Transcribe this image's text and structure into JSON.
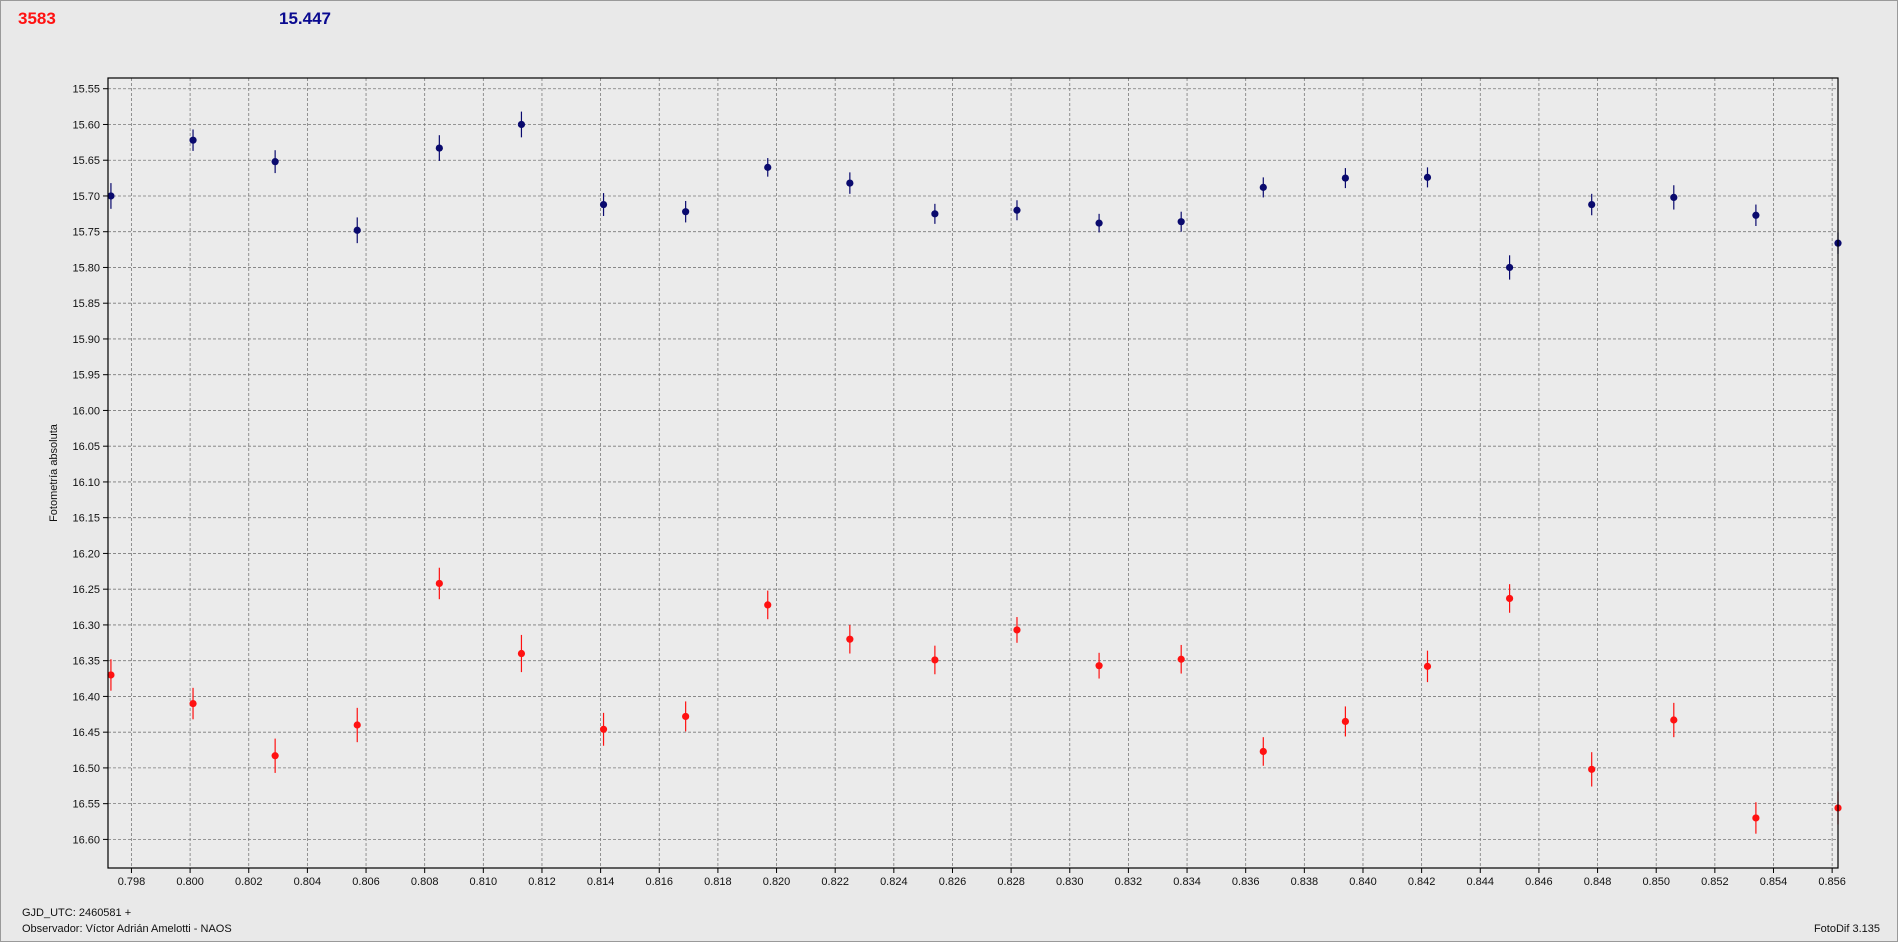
{
  "header": {
    "star_id": "3583",
    "value": "15.447",
    "star_color": "#ff1111",
    "value_color": "#0a0a90"
  },
  "footer": {
    "gjd": "GJD_UTC: 2460581 +",
    "observer": "Observador: Víctor Adrián Amelotti - NAOS",
    "software": "FotoDif 3.135"
  },
  "chart_data": {
    "type": "scatter",
    "ylabel": "Fotometría absoluta",
    "xlabel": "",
    "y_inverted": true,
    "xlim": [
      0.7972,
      0.8562
    ],
    "ylim": [
      15.535,
      16.64
    ],
    "grid": true,
    "x_ticks": [
      "0.798",
      "0.800",
      "0.802",
      "0.804",
      "0.806",
      "0.808",
      "0.810",
      "0.812",
      "0.814",
      "0.816",
      "0.818",
      "0.820",
      "0.822",
      "0.824",
      "0.826",
      "0.828",
      "0.830",
      "0.832",
      "0.834",
      "0.836",
      "0.838",
      "0.840",
      "0.842",
      "0.844",
      "0.846",
      "0.848",
      "0.850",
      "0.852",
      "0.854",
      "0.856"
    ],
    "y_ticks": [
      "15.55",
      "15.60",
      "15.65",
      "15.70",
      "15.75",
      "15.80",
      "15.85",
      "15.90",
      "15.95",
      "16.00",
      "16.05",
      "16.10",
      "16.15",
      "16.20",
      "16.25",
      "16.30",
      "16.35",
      "16.40",
      "16.45",
      "16.50",
      "16.55",
      "16.60"
    ],
    "x": [
      0.7973,
      0.8001,
      0.8029,
      0.8057,
      0.8085,
      0.8113,
      0.8141,
      0.8169,
      0.8197,
      0.8225,
      0.8254,
      0.8282,
      0.831,
      0.8338,
      0.8366,
      0.8394,
      0.8422,
      0.845,
      0.8478,
      0.8506,
      0.8534,
      0.8562
    ],
    "series": [
      {
        "color": "#0a0a6e",
        "y": [
          15.7,
          15.622,
          15.652,
          15.748,
          15.633,
          15.6,
          15.712,
          15.722,
          15.66,
          15.682,
          15.725,
          15.72,
          15.738,
          15.736,
          15.688,
          15.675,
          15.674,
          15.8,
          15.712,
          15.702,
          15.727,
          15.766
        ],
        "err": [
          0.018,
          0.015,
          0.016,
          0.018,
          0.018,
          0.018,
          0.016,
          0.015,
          0.013,
          0.015,
          0.014,
          0.014,
          0.013,
          0.014,
          0.014,
          0.014,
          0.014,
          0.017,
          0.015,
          0.017,
          0.015,
          0.015
        ]
      },
      {
        "color": "#ff1111",
        "y": [
          16.37,
          16.41,
          16.483,
          16.44,
          16.242,
          16.34,
          16.446,
          16.428,
          16.272,
          16.32,
          16.349,
          16.307,
          16.357,
          16.348,
          16.477,
          16.435,
          16.358,
          16.263,
          16.502,
          16.433,
          16.57,
          16.556
        ],
        "err": [
          0.022,
          0.022,
          0.024,
          0.024,
          0.022,
          0.026,
          0.023,
          0.021,
          0.02,
          0.02,
          0.02,
          0.018,
          0.018,
          0.02,
          0.02,
          0.021,
          0.022,
          0.02,
          0.024,
          0.024,
          0.022,
          0.023
        ]
      }
    ]
  }
}
